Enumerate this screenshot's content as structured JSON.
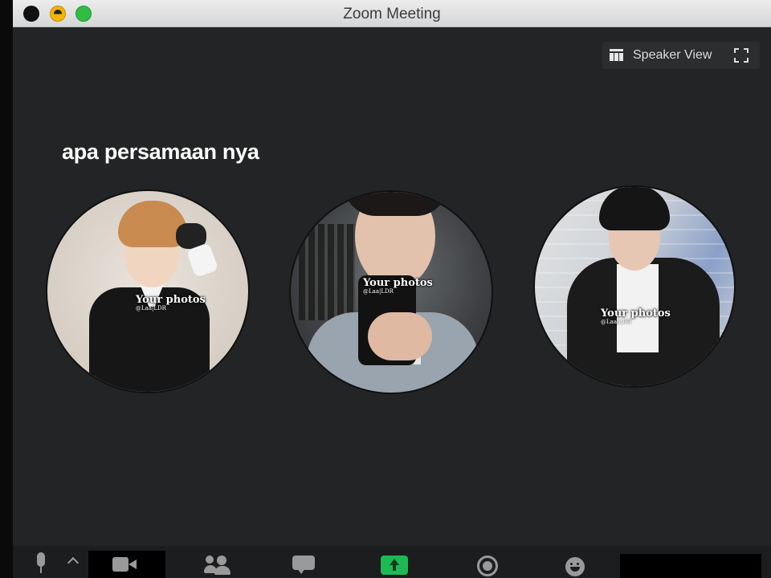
{
  "window": {
    "title": "Zoom Meeting"
  },
  "view_toggle": {
    "label": "Speaker View",
    "icon": "grid-icon",
    "fullscreen_icon": "fullscreen-icon"
  },
  "caption": "apa persamaan nya",
  "participants": [
    {
      "label": "Your photos",
      "credit": "@Laa|LDR"
    },
    {
      "label": "Your photos",
      "credit": "@Laa|LDR"
    },
    {
      "label": "Your photos",
      "credit": "@Laa|LDR"
    }
  ],
  "toolbar": {
    "icons": [
      "microphone-icon",
      "video-camera-icon",
      "participants-icon",
      "chat-icon",
      "share-screen-icon",
      "record-icon",
      "reactions-icon"
    ],
    "share_color": "#1db954"
  },
  "colors": {
    "background": "#222425",
    "titlebar": "#e0e0e0",
    "accent_green": "#2fbd45",
    "accent_yellow": "#f4b400"
  }
}
